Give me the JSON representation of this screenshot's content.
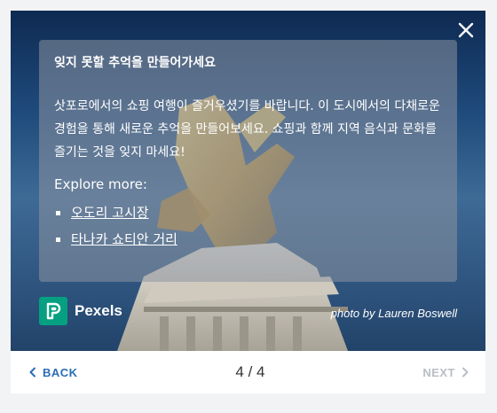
{
  "panel": {
    "title": "잊지 못할 추억을 만들어가세요",
    "body": "삿포로에서의 쇼핑 여행이 즐거우셨기를 바랍니다. 이 도시에서의 다채로운 경험을 통해 새로운 추억을 만들어보세요. 쇼핑과 함께 지역 음식과 문화를 즐기는 것을 잊지 마세요!",
    "explore_label": "Explore more:",
    "links": [
      "오도리 고시장",
      "타나카 쇼티안 거리"
    ]
  },
  "branding": {
    "name": "Pexels"
  },
  "credit": "photo by Lauren Boswell",
  "nav": {
    "back_label": "BACK",
    "page": "4 / 4",
    "next_label": "NEXT"
  },
  "colors": {
    "accent": "#2a6db5",
    "pexels_green": "#05a081",
    "disabled": "#b9bec4"
  },
  "icons": {
    "close": "close-icon",
    "back": "chevron-left-icon",
    "next": "chevron-right-icon",
    "logo": "pexels-logo-icon"
  }
}
